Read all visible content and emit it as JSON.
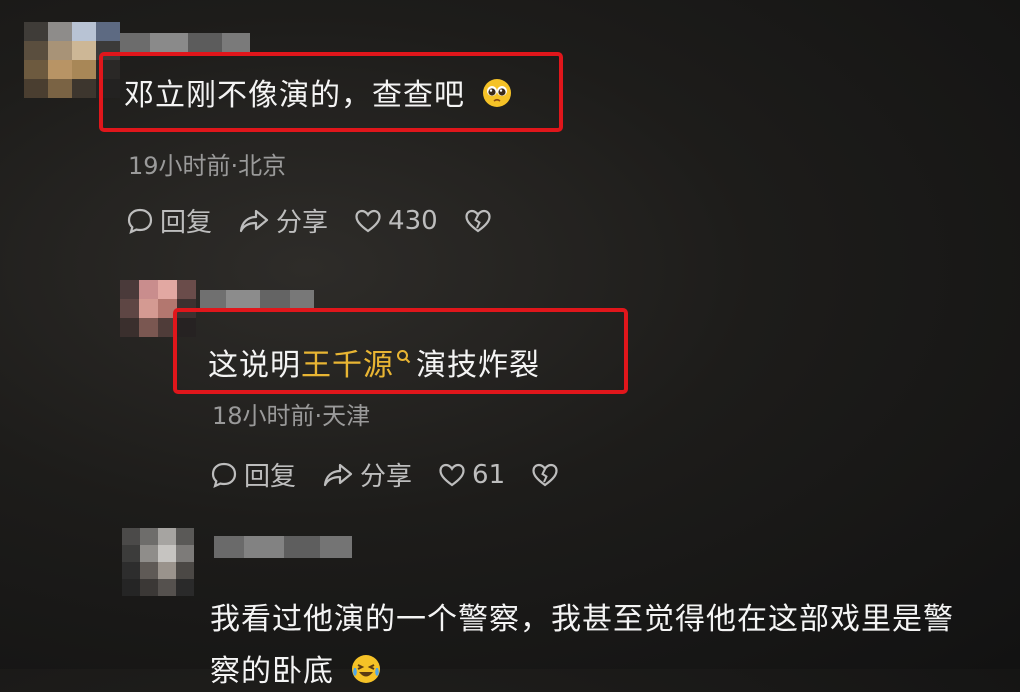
{
  "comments": [
    {
      "text": "邓立刚不像演的，查查吧",
      "time_location": "19小时前·北京",
      "reply_label": "回复",
      "share_label": "分享",
      "likes": "430",
      "emoji_icon": "pleading-face-icon"
    },
    {
      "text_prefix": "这说明",
      "keyword": "王千源",
      "text_suffix": "演技炸裂",
      "time_location": "18小时前·天津",
      "reply_label": "回复",
      "share_label": "分享",
      "likes": "61"
    },
    {
      "line1": "我看过他演的一个警察，我甚至觉得他在这部戏里是警",
      "line2": "察的卧底",
      "emoji_icon": "laughing-tears-icon"
    }
  ],
  "colors": {
    "highlight": "#e0161b",
    "keyword": "#e8b533",
    "meta": "#9a9a9a"
  }
}
